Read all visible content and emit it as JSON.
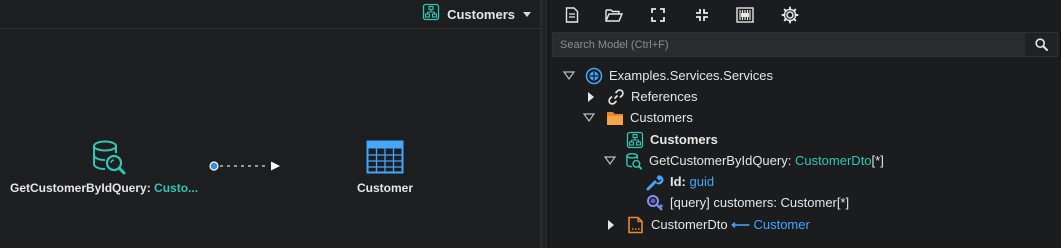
{
  "diagram": {
    "selector_label": "Customers",
    "nodes": {
      "query": {
        "name": "GetCustomerByIdQuery:",
        "type": "Custo..."
      },
      "customer": {
        "name": "Customer"
      }
    }
  },
  "toolbar": {
    "buttons": [
      "new-file",
      "open-folder",
      "expand",
      "collapse",
      "barcode",
      "settings"
    ]
  },
  "search": {
    "placeholder": "Search Model (Ctrl+F)",
    "value": ""
  },
  "tree": {
    "root": {
      "label": "Examples.Services.Services"
    },
    "references": {
      "label": "References"
    },
    "customers_folder": {
      "label": "Customers"
    },
    "customers_diagram": {
      "label": "Customers"
    },
    "query": {
      "name": "GetCustomerByIdQuery:",
      "type": "CustomerDto",
      "suffix": "[*]"
    },
    "id_param": {
      "name": "Id:",
      "type": "guid"
    },
    "query_param": {
      "label": "[query] customers: Customer[*]"
    },
    "dto": {
      "name": "CustomerDto",
      "arrow": "⟵",
      "mapped": "Customer"
    }
  },
  "colors": {
    "accent_teal": "#2fc6b4",
    "accent_blue": "#43a6ff",
    "background": "#1b1c1e"
  }
}
